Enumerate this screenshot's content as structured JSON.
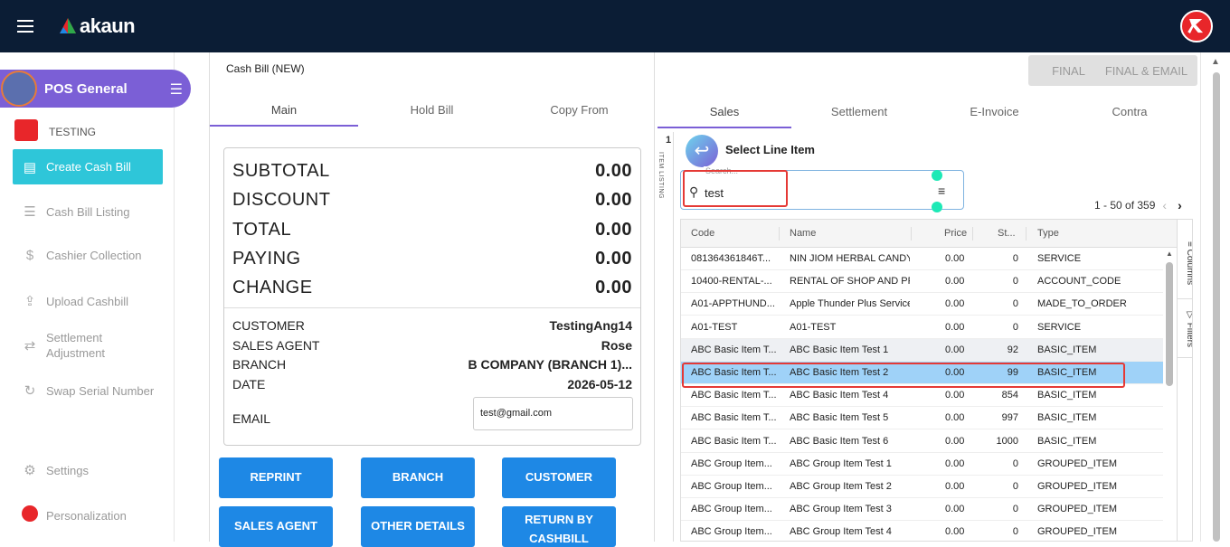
{
  "topbar": {
    "brand": "akaun"
  },
  "sidebar": {
    "app_title": "POS General",
    "company": "TESTING",
    "items": [
      {
        "label": "Create Cash Bill",
        "icon": "cash-register-icon",
        "active": true
      },
      {
        "label": "Cash Bill Listing",
        "icon": "list-icon",
        "active": false
      },
      {
        "label": "Cashier Collection",
        "icon": "dollar-icon",
        "active": false
      },
      {
        "label": "Upload Cashbill",
        "icon": "upload-icon",
        "active": false
      },
      {
        "label": "Settlement\nAdjustment",
        "icon": "swap-arrows-icon",
        "active": false
      },
      {
        "label": "Swap Serial Number",
        "icon": "refresh-icon",
        "active": false
      },
      {
        "label": "Settings",
        "icon": "gear-icon",
        "active": false
      },
      {
        "label": "Personalization",
        "icon": "user-logo-icon",
        "active": false
      }
    ]
  },
  "left_panel": {
    "title": "Cash Bill (NEW)",
    "tabs": [
      "Main",
      "Hold Bill",
      "Copy From"
    ],
    "summary": {
      "subtotal_label": "SUBTOTAL",
      "subtotal": "0.00",
      "discount_label": "DISCOUNT",
      "discount": "0.00",
      "total_label": "TOTAL",
      "total": "0.00",
      "paying_label": "PAYING",
      "paying": "0.00",
      "change_label": "CHANGE",
      "change": "0.00"
    },
    "info": {
      "customer_label": "CUSTOMER",
      "customer": "TestingAng14",
      "agent_label": "SALES AGENT",
      "agent": "Rose",
      "branch_label": "BRANCH",
      "branch": "B COMPANY (BRANCH 1)...",
      "date_label": "DATE",
      "date": "2026-05-12",
      "email_label": "EMAIL",
      "email": "test@gmail.com"
    },
    "buttons": [
      "REPRINT",
      "BRANCH",
      "CUSTOMER",
      "SALES AGENT",
      "OTHER DETAILS",
      "RETURN BY CASHBILL"
    ]
  },
  "right_panel": {
    "final_label": "FINAL",
    "final_email_label": "FINAL & EMAIL",
    "tabs": [
      "Sales",
      "Settlement",
      "E-Invoice",
      "Contra"
    ],
    "strip_number": "1",
    "strip_label": "ITEM LISTING",
    "select_title": "Select Line Item",
    "search": {
      "placeholder": "Search...",
      "value": "test"
    },
    "pager": "1 - 50 of 359",
    "columns": [
      "Code",
      "Name",
      "Price",
      "St...",
      "Type"
    ],
    "tool_columns": "Columns",
    "tool_filters": "Filters",
    "rows": [
      [
        "081364361846T...",
        "NIN JIOM HERBAL CANDY G",
        "0.00",
        "0",
        "SERVICE"
      ],
      [
        "10400-RENTAL-...",
        "RENTAL OF SHOP AND PREI",
        "0.00",
        "0",
        "ACCOUNT_CODE"
      ],
      [
        "A01-APPTHUND...",
        "Apple Thunder Plus Service",
        "0.00",
        "0",
        "MADE_TO_ORDER"
      ],
      [
        "A01-TEST",
        "A01-TEST",
        "0.00",
        "0",
        "SERVICE"
      ],
      [
        "ABC Basic Item T...",
        "ABC Basic Item Test 1",
        "0.00",
        "92",
        "BASIC_ITEM"
      ],
      [
        "ABC Basic Item T...",
        "ABC Basic Item Test 2",
        "0.00",
        "99",
        "BASIC_ITEM"
      ],
      [
        "ABC Basic Item T...",
        "ABC Basic Item Test 4",
        "0.00",
        "854",
        "BASIC_ITEM"
      ],
      [
        "ABC Basic Item T...",
        "ABC Basic Item Test 5",
        "0.00",
        "997",
        "BASIC_ITEM"
      ],
      [
        "ABC Basic Item T...",
        "ABC Basic Item Test 6",
        "0.00",
        "1000",
        "BASIC_ITEM"
      ],
      [
        "ABC Group Item...",
        "ABC Group Item Test 1",
        "0.00",
        "0",
        "GROUPED_ITEM"
      ],
      [
        "ABC Group Item...",
        "ABC Group Item Test 2",
        "0.00",
        "0",
        "GROUPED_ITEM"
      ],
      [
        "ABC Group Item...",
        "ABC Group Item Test 3",
        "0.00",
        "0",
        "GROUPED_ITEM"
      ],
      [
        "ABC Group Item...",
        "ABC Group Item Test 4",
        "0.00",
        "0",
        "GROUPED_ITEM"
      ]
    ]
  },
  "colors": {
    "accent": "#7b5fd6",
    "active_nav": "#2ec6d9",
    "button": "#1e88e5",
    "selected_row": "#9fd2f8",
    "highlight": "#e53935",
    "topbar": "#0b1d35"
  }
}
